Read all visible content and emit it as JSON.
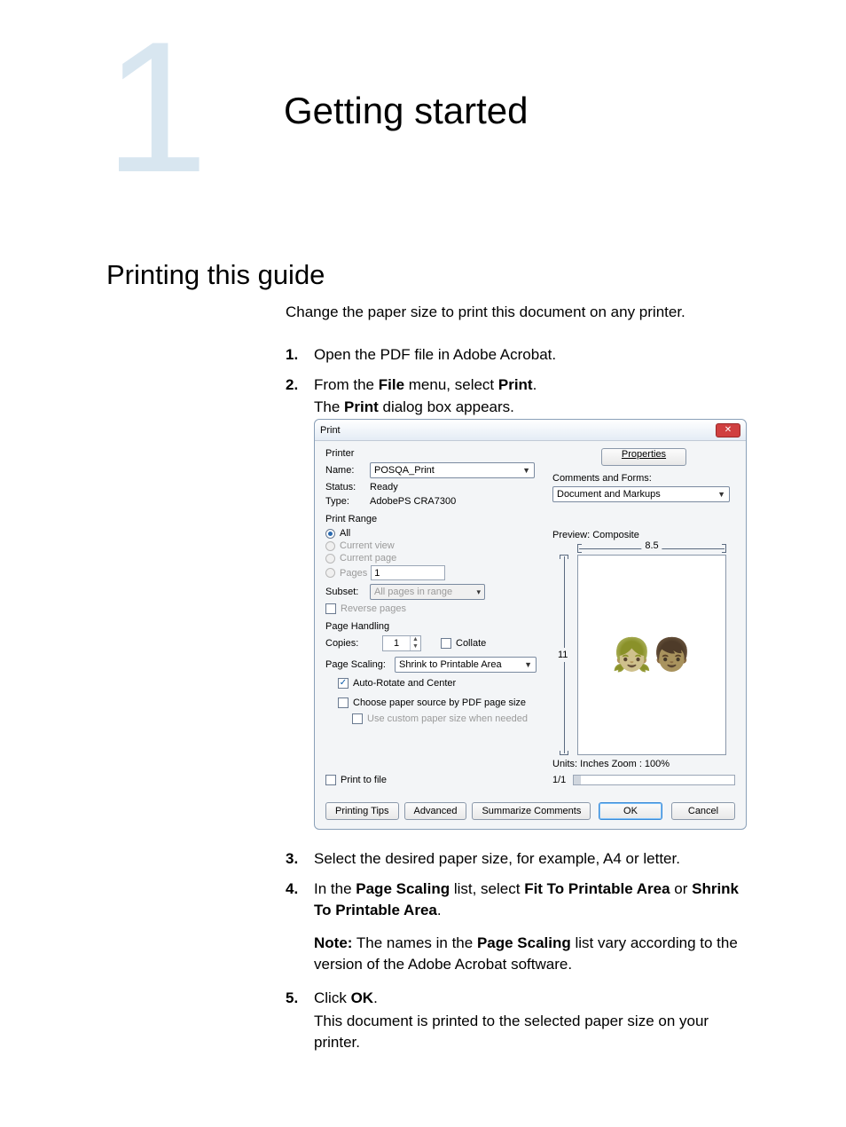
{
  "chapter": {
    "number": "1",
    "title": "Getting started"
  },
  "section": {
    "title": "Printing this guide"
  },
  "intro": "Change the paper size to print this document on any printer.",
  "steps": {
    "s1": {
      "num": "1.",
      "text": "Open the PDF file in Adobe Acrobat."
    },
    "s2": {
      "num": "2.",
      "line1_a": "From the ",
      "line1_b": "File",
      "line1_c": " menu, select ",
      "line1_d": "Print",
      "line1_e": ".",
      "line2_a": "The ",
      "line2_b": "Print",
      "line2_c": " dialog box appears."
    },
    "s3": {
      "num": "3.",
      "text": "Select the desired paper size, for example, A4 or letter."
    },
    "s4": {
      "num": "4.",
      "a": "In the ",
      "b": "Page Scaling",
      "c": " list, select ",
      "d": "Fit To Printable Area",
      "e": " or ",
      "f": "Shrink To Printable Area",
      "g": ".",
      "note_a": "Note:",
      "note_b": " The names in the ",
      "note_c": "Page Scaling",
      "note_d": " list vary according to the version of the Adobe Acrobat software."
    },
    "s5": {
      "num": "5.",
      "a": "Click ",
      "b": "OK",
      "c": ".",
      "line2": "This document is printed to the selected paper size on your printer."
    }
  },
  "dialog": {
    "title": "Print",
    "printer_grp": "Printer",
    "name_label": "Name:",
    "name_value": "POSQA_Print",
    "status_label": "Status:",
    "status_value": "Ready",
    "type_label": "Type:",
    "type_value": "AdobePS CRA7300",
    "properties_btn": "Properties",
    "cf_label": "Comments and Forms:",
    "cf_value": "Document and Markups",
    "range_grp": "Print Range",
    "r_all": "All",
    "r_view": "Current view",
    "r_page": "Current page",
    "r_pages": "Pages",
    "r_pages_value": "1",
    "subset_label": "Subset:",
    "subset_value": "All pages in range",
    "reverse": "Reverse pages",
    "ph_grp": "Page Handling",
    "copies_label": "Copies:",
    "copies_value": "1",
    "collate": "Collate",
    "scaling_label": "Page Scaling:",
    "scaling_value": "Shrink to Printable Area",
    "autorotate": "Auto-Rotate and Center",
    "choose_src": "Choose paper source by PDF page size",
    "custom_size": "Use custom paper size when needed",
    "print_to_file": "Print to file",
    "preview_label": "Preview: Composite",
    "width": "8.5",
    "height": "11",
    "units": "Units: Inches Zoom : 100%",
    "page_of": "1/1",
    "tips_btn": "Printing Tips",
    "advanced_btn": "Advanced",
    "summarize_btn": "Summarize Comments",
    "ok_btn": "OK",
    "cancel_btn": "Cancel"
  }
}
